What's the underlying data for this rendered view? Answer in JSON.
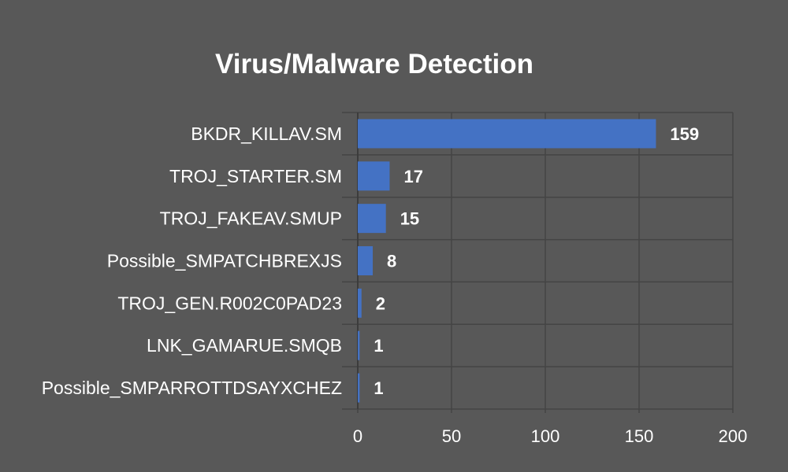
{
  "chart_data": {
    "type": "bar",
    "orientation": "horizontal",
    "title": "Virus/Malware Detection",
    "xlabel": "",
    "ylabel": "",
    "xlim": [
      0,
      200
    ],
    "xticks": [
      0,
      50,
      100,
      150,
      200
    ],
    "grid": true,
    "bar_color": "#4472c4",
    "background_color": "#585858",
    "text_color": "#ffffff",
    "categories": [
      "BKDR_KILLAV.SM",
      "TROJ_STARTER.SM",
      "TROJ_FAKEAV.SMUP",
      "Possible_SMPATCHBREXJS",
      "TROJ_GEN.R002C0PAD23",
      "LNK_GAMARUE.SMQB",
      "Possible_SMPARROTTDSAYXCHEZ"
    ],
    "values": [
      159,
      17,
      15,
      8,
      2,
      1,
      1
    ]
  }
}
